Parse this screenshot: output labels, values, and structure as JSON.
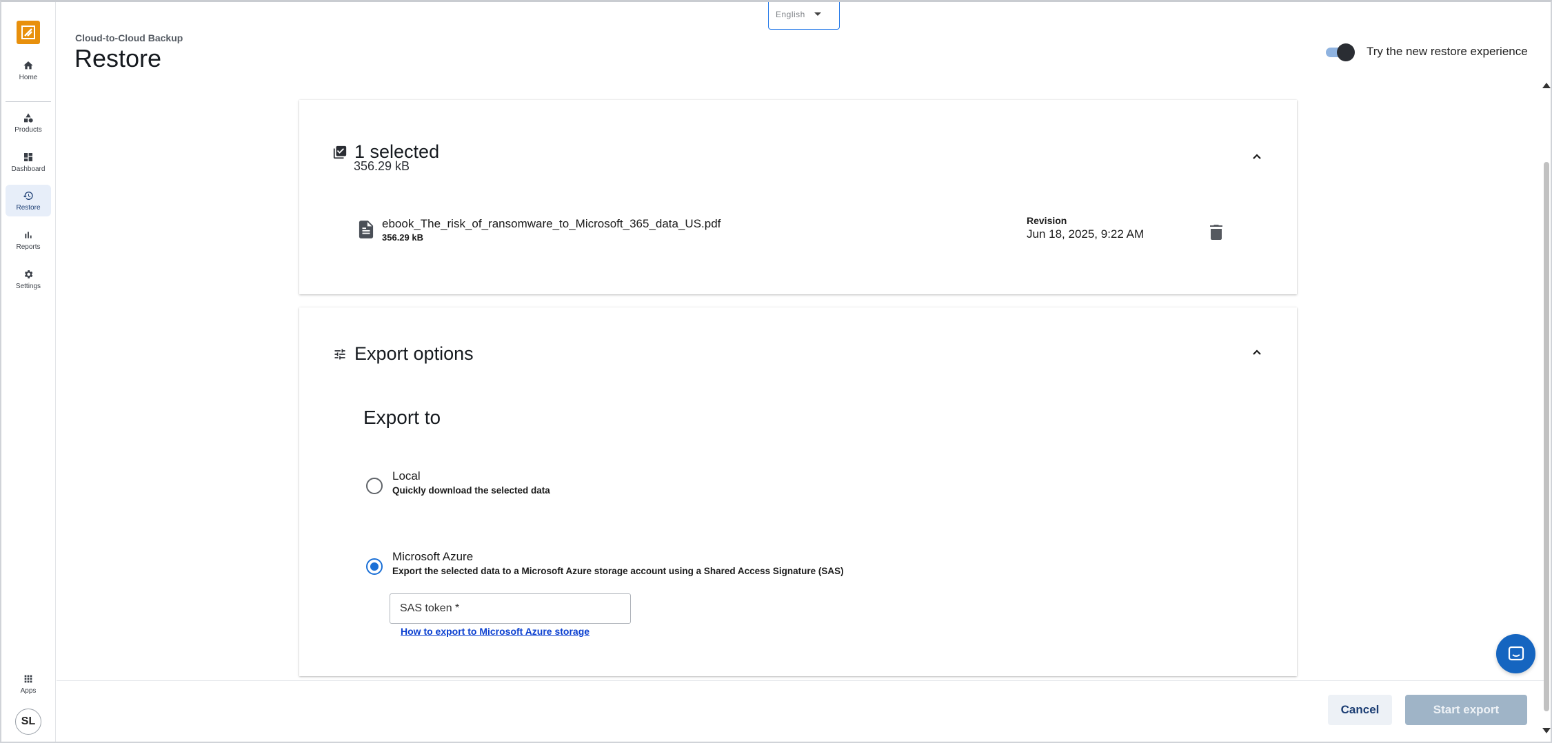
{
  "nav": {
    "items": [
      {
        "label": "Home",
        "icon": "home-icon"
      },
      {
        "label": "Products",
        "icon": "shapes-icon"
      },
      {
        "label": "Dashboard",
        "icon": "dashboard-icon"
      },
      {
        "label": "Restore",
        "icon": "history-icon",
        "active": true
      },
      {
        "label": "Reports",
        "icon": "bar-chart-icon"
      },
      {
        "label": "Settings",
        "icon": "gear-icon"
      }
    ],
    "apps_label": "Apps",
    "avatar_initials": "SL"
  },
  "header": {
    "breadcrumb": "Cloud-to-Cloud Backup",
    "title": "Restore",
    "language_value": "English",
    "toggle_label": "Try the new restore experience",
    "toggle_on": true
  },
  "selection": {
    "title": "1 selected",
    "total_size": "356.29 kB",
    "file": {
      "name": "ebook_The_risk_of_ransomware_to_Microsoft_365_data_US.pdf",
      "size": "356.29 kB",
      "revision_label": "Revision",
      "revision_date": "Jun 18, 2025, 9:22 AM"
    }
  },
  "export": {
    "title": "Export options",
    "export_to_heading": "Export to",
    "options": [
      {
        "title": "Local",
        "description": "Quickly download the selected data",
        "checked": false
      },
      {
        "title": "Microsoft Azure",
        "description": "Export the selected data to a Microsoft Azure storage account using a Shared Access Signature (SAS)",
        "checked": true
      }
    ],
    "sas_placeholder": "SAS token *",
    "help_link": "How to export to Microsoft Azure storage"
  },
  "footer": {
    "cancel_label": "Cancel",
    "start_label": "Start export"
  },
  "colors": {
    "accent": "#1a6fd6",
    "brand": "#e8900c",
    "primary_dark": "#1b3d73",
    "disabled_button": "#9fb4c7"
  }
}
